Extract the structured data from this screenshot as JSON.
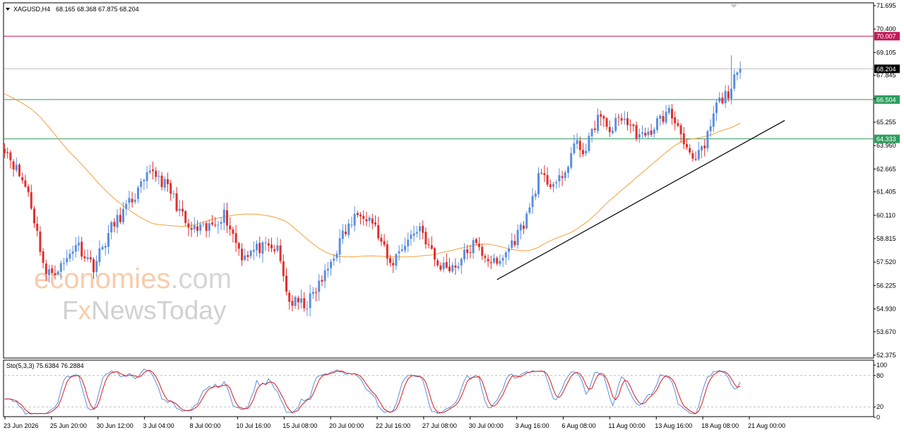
{
  "header": {
    "symbol": "XAGUSD,H4",
    "ohlc": "68.165 68.368 67.875 68.204"
  },
  "watermark": {
    "line1_part1": "economies",
    "line1_part2": ".com",
    "line2_part1": "F",
    "line2_part2": "x",
    "line2_part3": "NewsToday"
  },
  "colors": {
    "bull": "#5b8fdf",
    "bear": "#e0312e",
    "ma": "#f5a13c",
    "resistance": "#c2185b",
    "support": "#2e9e5e",
    "current": "#000000",
    "stoch_main": "#5b8fdf",
    "stoch_signal": "#d81b1b"
  },
  "chart_data": {
    "type": "candlestick",
    "symbol": "XAGUSD",
    "timeframe": "H4",
    "ylim": [
      52.375,
      71.695
    ],
    "yticks": [
      71.695,
      70.4,
      69.105,
      67.845,
      66.55,
      65.255,
      63.96,
      62.665,
      61.405,
      60.11,
      58.815,
      57.52,
      56.225,
      54.93,
      53.67,
      52.375
    ],
    "xticks": [
      "23 Jun 2026",
      "25 Jun 20:00",
      "30 Jun 12:00",
      "3 Jul 04:00",
      "8 Jul 00:00",
      "10 Jul 16:00",
      "15 Jul 08:00",
      "20 Jul 00:00",
      "22 Jul 16:00",
      "27 Jul 08:00",
      "30 Jul 00:00",
      "3 Aug 16:00",
      "6 Aug 08:00",
      "11 Aug 00:00",
      "13 Aug 16:00",
      "18 Aug 08:00",
      "21 Aug 00:00"
    ],
    "levels": [
      {
        "value": 70.007,
        "label": "70.007",
        "kind": "resistance"
      },
      {
        "value": 66.504,
        "label": "66.504",
        "kind": "support"
      },
      {
        "value": 64.333,
        "label": "64.333",
        "kind": "support"
      },
      {
        "value": 68.204,
        "label": "68.204",
        "kind": "current"
      }
    ],
    "trendline": {
      "from": {
        "bar": 166,
        "price": 56.55
      },
      "to": {
        "bar": 263,
        "price": 65.35
      }
    },
    "waypoints": [
      [
        0,
        63.9
      ],
      [
        8,
        61.4
      ],
      [
        14,
        56.8
      ],
      [
        20,
        57.4
      ],
      [
        24,
        58.6
      ],
      [
        30,
        57.3
      ],
      [
        36,
        59.4
      ],
      [
        44,
        61.2
      ],
      [
        50,
        62.6
      ],
      [
        56,
        61.4
      ],
      [
        62,
        59.3
      ],
      [
        68,
        59.3
      ],
      [
        74,
        60.2
      ],
      [
        80,
        57.9
      ],
      [
        86,
        58.3
      ],
      [
        92,
        58.2
      ],
      [
        96,
        55.3
      ],
      [
        102,
        55.2
      ],
      [
        108,
        56.8
      ],
      [
        114,
        59.0
      ],
      [
        120,
        60.4
      ],
      [
        124,
        59.8
      ],
      [
        130,
        57.3
      ],
      [
        134,
        58.4
      ],
      [
        140,
        59.5
      ],
      [
        146,
        57.3
      ],
      [
        152,
        57.3
      ],
      [
        158,
        58.5
      ],
      [
        166,
        57.3
      ],
      [
        172,
        58.8
      ],
      [
        176,
        60.0
      ],
      [
        180,
        62.2
      ],
      [
        184,
        61.9
      ],
      [
        188,
        62.0
      ],
      [
        192,
        64.0
      ],
      [
        196,
        63.7
      ],
      [
        200,
        65.6
      ],
      [
        204,
        64.8
      ],
      [
        208,
        65.6
      ],
      [
        212,
        64.8
      ],
      [
        216,
        64.3
      ],
      [
        220,
        65.3
      ],
      [
        224,
        65.8
      ],
      [
        228,
        64.8
      ],
      [
        232,
        62.9
      ],
      [
        236,
        63.9
      ],
      [
        240,
        66.2
      ],
      [
        244,
        66.9
      ],
      [
        248,
        68.2
      ]
    ],
    "ma_period": 50,
    "stochastic": {
      "label": "Sto(5,3,3) 75.6384 76.2884",
      "ylim": [
        0,
        100
      ],
      "yticks": [
        100,
        80,
        20,
        0
      ],
      "levels": [
        80,
        20
      ]
    }
  }
}
